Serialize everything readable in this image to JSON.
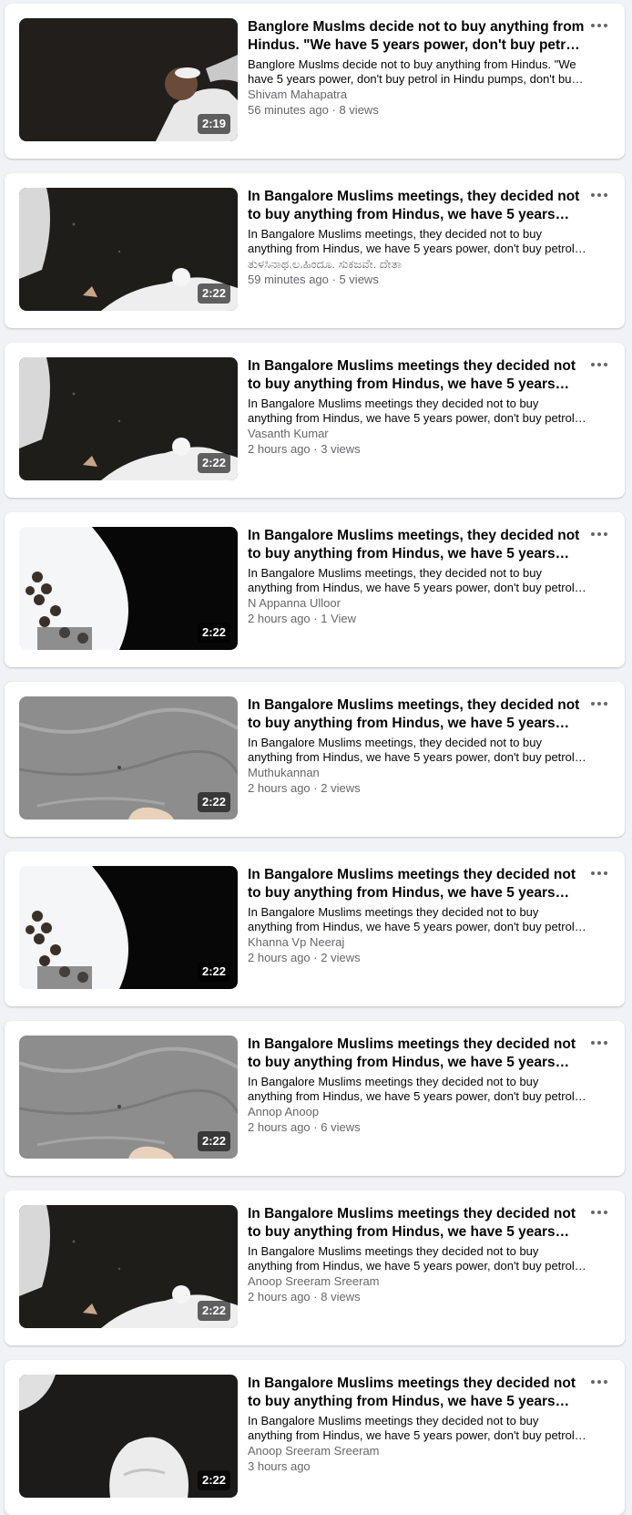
{
  "results": [
    {
      "title": "Banglore Muslms decide not to buy anything from Hindus. \"We have 5 years power, don't buy petrol in Hindu pumps\"",
      "description": "Banglore Muslms decide not to buy anything from Hindus. \"We have 5 years power, don't buy petrol in Hindu pumps, don't buy anything from Hindu shops\"",
      "author": "Shivam Mahapatra",
      "time": "56 minutes ago",
      "views": "8 views",
      "duration": "2:19",
      "thumbnail": "speaker-closeup"
    },
    {
      "title": "In Bangalore Muslims meetings, they decided not to buy anything from Hindus, we have 5 years power, don't buy petrol",
      "description": "In Bangalore Muslims meetings, they decided not to buy anything from Hindus, we have 5 years power, don't buy petrol in Hindu pumps",
      "author": "ತುಳಸಿನಾಥ.ಲ.ಹಿಂದೂ. ಸುಕಜವೇ. ದೇತಾ",
      "time": "59 minutes ago",
      "views": "5 views",
      "duration": "2:22",
      "thumbnail": "dark-white-cloth"
    },
    {
      "title": "In Bangalore Muslims meetings they decided not to buy anything from Hindus, we have 5 years power, don't buy petrol",
      "description": "In Bangalore Muslims meetings they decided not to buy anything from Hindus, we have 5 years power, don't buy petrol in Hindu pumps",
      "author": "Vasanth Kumar",
      "time": "2 hours ago",
      "views": "3 views",
      "duration": "2:22",
      "thumbnail": "dark-white-cloth"
    },
    {
      "title": "In Bangalore Muslims meetings, they decided not to buy anything from Hindus, we have 5 years power, don't buy petrol",
      "description": "In Bangalore Muslims meetings, they decided not to buy anything from Hindus, we have 5 years power, don't buy petrol in Hindu pumps",
      "author": "N Appanna Ulloor",
      "time": "2 hours ago",
      "views": "1 View",
      "duration": "2:22",
      "thumbnail": "crowd-dark"
    },
    {
      "title": "In Bangalore Muslims meetings, they decided not to buy anything from Hindus, we have 5 years power, don't buy petrol",
      "description": "In Bangalore Muslims meetings, they decided not to buy anything from Hindus, we have 5 years power, don't buy petrol in Hindu pumps",
      "author": "Muthukannan",
      "time": "2 hours ago",
      "views": "2 views",
      "duration": "2:22",
      "thumbnail": "grey-cloth"
    },
    {
      "title": "In Bangalore Muslims meetings they decided not to buy anything from Hindus, we have 5 years power, don't buy petrol",
      "description": "In Bangalore Muslims meetings they decided not to buy anything from Hindus, we have 5 years power, don't buy petrol in Hindu pumps",
      "author": "Khanna Vp Neeraj",
      "time": "2 hours ago",
      "views": "2 views",
      "duration": "2:22",
      "thumbnail": "crowd-dark"
    },
    {
      "title": "In Bangalore Muslims meetings they decided not to buy anything from Hindus, we have 5 years power, don't buy petrol",
      "description": "In Bangalore Muslims meetings they decided not to buy anything from Hindus, we have 5 years power, don't buy petrol in Hindu pumps",
      "author": "Annop Anoop",
      "time": "2 hours ago",
      "views": "6 views",
      "duration": "2:22",
      "thumbnail": "grey-cloth"
    },
    {
      "title": "In Bangalore Muslims meetings they decided not to buy anything from Hindus, we have 5 years power, don't buy petrol",
      "description": "In Bangalore Muslims meetings they decided not to buy anything from Hindus, we have 5 years power, don't buy petrol in Hindu pumps",
      "author": "Anoop Sreeram Sreeram",
      "time": "2 hours ago",
      "views": "8 views",
      "duration": "2:22",
      "thumbnail": "dark-white-cloth"
    },
    {
      "title": "In Bangalore Muslims meetings they decided not to buy anything from Hindus, we have 5 years power, don't buy petrol",
      "description": "In Bangalore Muslims meetings they decided not to buy anything from Hindus, we have 5 years power, don't buy petrol in Hindu pumps",
      "author": "Anoop Sreeram Sreeram",
      "time": "3 hours ago",
      "views": "",
      "duration": "2:22",
      "thumbnail": "white-sleeve"
    }
  ],
  "icons": {
    "more": "more-horizontal-icon"
  },
  "colors": {
    "card": "#ffffff",
    "background": "#f0f2f5",
    "secondary_text": "#65676b"
  }
}
